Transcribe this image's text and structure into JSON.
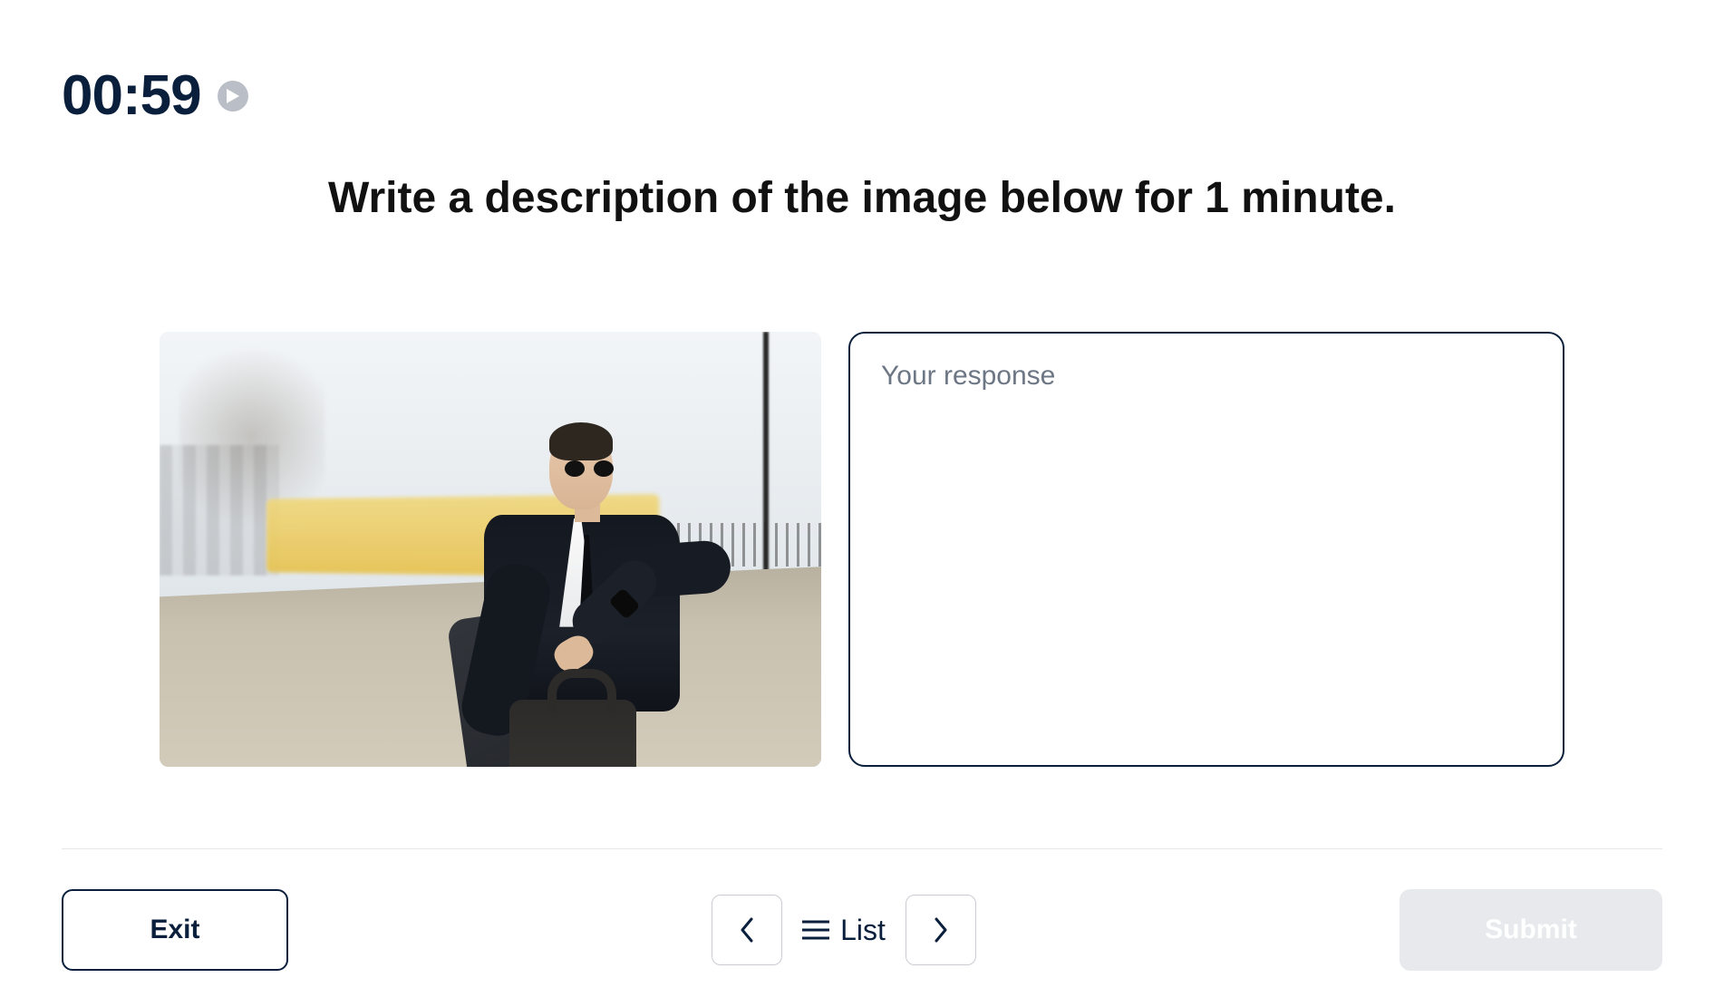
{
  "timer": {
    "value": "00:59"
  },
  "prompt": {
    "text": "Write a description of the image below for 1 minute."
  },
  "response": {
    "placeholder": "Your response",
    "value": ""
  },
  "footer": {
    "exit_label": "Exit",
    "list_label": "List",
    "submit_label": "Submit"
  },
  "image": {
    "alt": "A man in a dark business suit, sunglasses and tie stands on an outdoor tram platform. He is looking down at his wristwatch while holding a folded coat and a dark leather briefcase. A yellow tram, bare trees and a railing are blurred in the background on an overcast day."
  }
}
